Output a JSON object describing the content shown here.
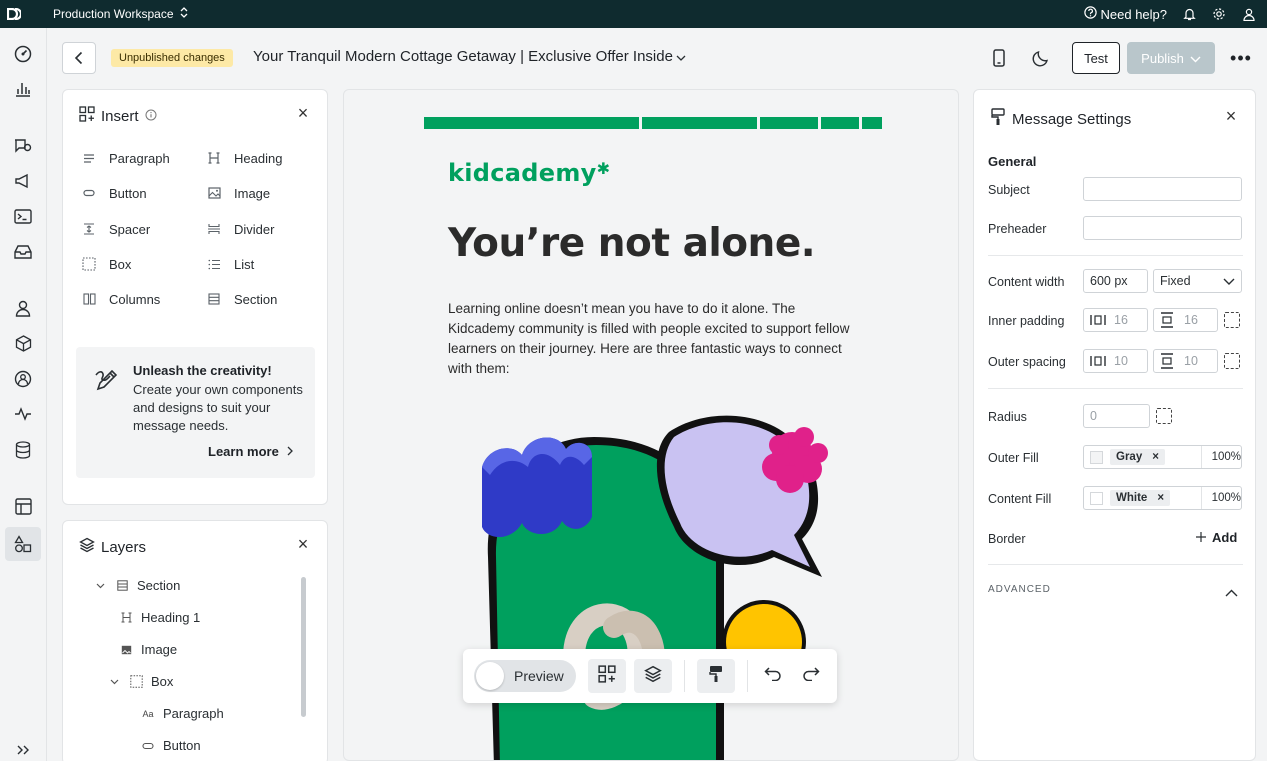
{
  "topbar": {
    "workspace": "Production Workspace",
    "help": "Need help?"
  },
  "header": {
    "badge": "Unpublished changes",
    "message_title": "Your Tranquil Modern Cottage Getaway | Exclusive Offer Inside",
    "test_label": "Test",
    "publish_label": "Publish",
    "more_label": "•••"
  },
  "insert": {
    "title": "Insert",
    "items": [
      {
        "label": "Paragraph",
        "icon": "paragraph-icon"
      },
      {
        "label": "Heading",
        "icon": "heading-icon"
      },
      {
        "label": "Button",
        "icon": "button-icon"
      },
      {
        "label": "Image",
        "icon": "image-icon"
      },
      {
        "label": "Spacer",
        "icon": "spacer-icon"
      },
      {
        "label": "Divider",
        "icon": "divider-icon"
      },
      {
        "label": "Box",
        "icon": "box-icon"
      },
      {
        "label": "List",
        "icon": "list-icon"
      },
      {
        "label": "Columns",
        "icon": "columns-icon"
      },
      {
        "label": "Section",
        "icon": "section-icon"
      }
    ],
    "promo": {
      "title": "Unleash the creativity!",
      "description": "Create your own components and designs to suit your message needs.",
      "link": "Learn more"
    }
  },
  "layers": {
    "title": "Layers",
    "items": [
      {
        "label": "Section",
        "icon": "section-icon"
      },
      {
        "label": "Heading 1",
        "icon": "heading-icon"
      },
      {
        "label": "Image",
        "icon": "image-icon"
      },
      {
        "label": "Box",
        "icon": "box-icon"
      },
      {
        "label": "Paragraph",
        "icon": "paragraph-aa-icon"
      },
      {
        "label": "Button",
        "icon": "button-icon"
      }
    ]
  },
  "email": {
    "brand": "kidcademy",
    "headline": "You’re not alone.",
    "body": "Learning online doesn’t mean you have to do it alone. The Kidcademy community is filled with people excited to support fellow learners on their journey. Here are three fantastic ways to connect with them:",
    "accent_color": "#00a05e"
  },
  "toolbar": {
    "preview_label": "Preview"
  },
  "settings": {
    "title": "Message Settings",
    "general_label": "General",
    "subject_label": "Subject",
    "subject_value": "",
    "preheader_label": "Preheader",
    "preheader_value": "",
    "content_width_label": "Content width",
    "content_width_value": "600 px",
    "content_width_mode": "Fixed",
    "inner_padding_label": "Inner padding",
    "inner_padding_h": "16",
    "inner_padding_v": "16",
    "outer_spacing_label": "Outer spacing",
    "outer_spacing_h": "10",
    "outer_spacing_v": "10",
    "radius_label": "Radius",
    "radius_value": "0",
    "outer_fill_label": "Outer Fill",
    "outer_fill_value": "Gray",
    "outer_fill_opacity": "100%",
    "content_fill_label": "Content Fill",
    "content_fill_value": "White",
    "content_fill_opacity": "100%",
    "border_label": "Border",
    "border_add": "Add",
    "advanced_label": "ADVANCED"
  }
}
